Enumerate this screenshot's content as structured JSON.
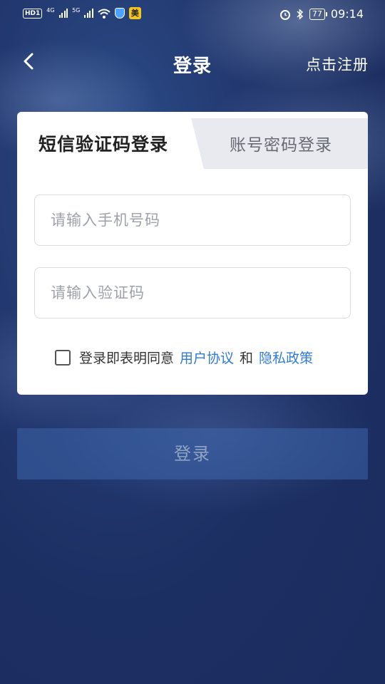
{
  "status_bar": {
    "hd_tag": "HD",
    "sim1": "1",
    "net1": "4G",
    "net2": "5G",
    "app_badge": "美",
    "battery": "77",
    "time": "09:14"
  },
  "header": {
    "title": "登录",
    "register_label": "点击注册"
  },
  "tabs": {
    "sms_login": "短信验证码登录",
    "password_login": "账号密码登录"
  },
  "form": {
    "phone_placeholder": "请输入手机号码",
    "code_placeholder": "请输入验证码"
  },
  "agreement": {
    "prefix": "登录即表明同意",
    "user_agreement": "用户协议",
    "and": "和",
    "privacy_policy": "隐私政策",
    "checked": false
  },
  "login_button": "登录",
  "colors": {
    "link": "#2f7bd6",
    "background": "#1f3468"
  }
}
